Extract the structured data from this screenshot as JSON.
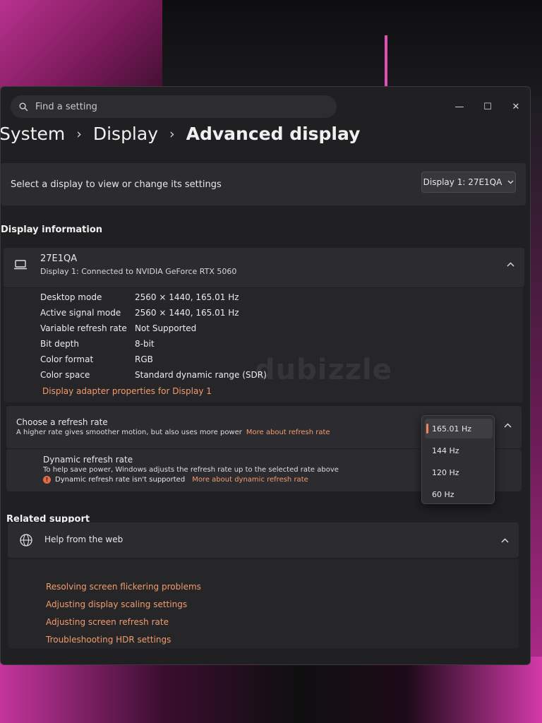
{
  "search": {
    "placeholder": "Find a setting"
  },
  "window_controls": {
    "minimize": "—",
    "maximize": "☐",
    "close": "✕"
  },
  "breadcrumb": {
    "root": "System",
    "mid": "Display",
    "current": "Advanced display",
    "separator": "›"
  },
  "select_display": {
    "label": "Select a display to view or change its settings",
    "dropdown_value": "Display 1: 27E1QA"
  },
  "display_information": {
    "section_title": "Display information",
    "monitor_name": "27E1QA",
    "connection": "Display 1: Connected to NVIDIA GeForce RTX 5060",
    "rows": [
      {
        "key": "Desktop mode",
        "value": "2560 × 1440, 165.01 Hz"
      },
      {
        "key": "Active signal mode",
        "value": "2560 × 1440, 165.01 Hz"
      },
      {
        "key": "Variable refresh rate",
        "value": "Not Supported"
      },
      {
        "key": "Bit depth",
        "value": "8-bit"
      },
      {
        "key": "Color format",
        "value": "RGB"
      },
      {
        "key": "Color space",
        "value": "Standard dynamic range (SDR)"
      }
    ],
    "adapter_link": "Display adapter properties for Display 1"
  },
  "refresh_rate": {
    "title": "Choose a refresh rate",
    "description": "A higher rate gives smoother motion, but also uses more power",
    "more_link": "More about refresh rate",
    "options": [
      "165.01 Hz",
      "144 Hz",
      "120 Hz",
      "60 Hz"
    ],
    "selected": "165.01 Hz"
  },
  "dynamic_refresh": {
    "title": "Dynamic refresh rate",
    "description": "To help save power, Windows adjusts the refresh rate up to the selected rate above",
    "warning": "Dynamic refresh rate isn't supported",
    "more_link": "More about dynamic refresh rate"
  },
  "related_support": {
    "section_title": "Related support",
    "help_title": "Help from the web",
    "links": [
      "Resolving screen flickering problems",
      "Adjusting display scaling settings",
      "Adjusting screen refresh rate",
      "Troubleshooting HDR settings"
    ]
  },
  "watermark": "dubizzle",
  "colors": {
    "accent_link": "#f29b6e",
    "warning": "#e36c46",
    "window_bg": "#202023",
    "card_bg": "#2c2c30"
  }
}
